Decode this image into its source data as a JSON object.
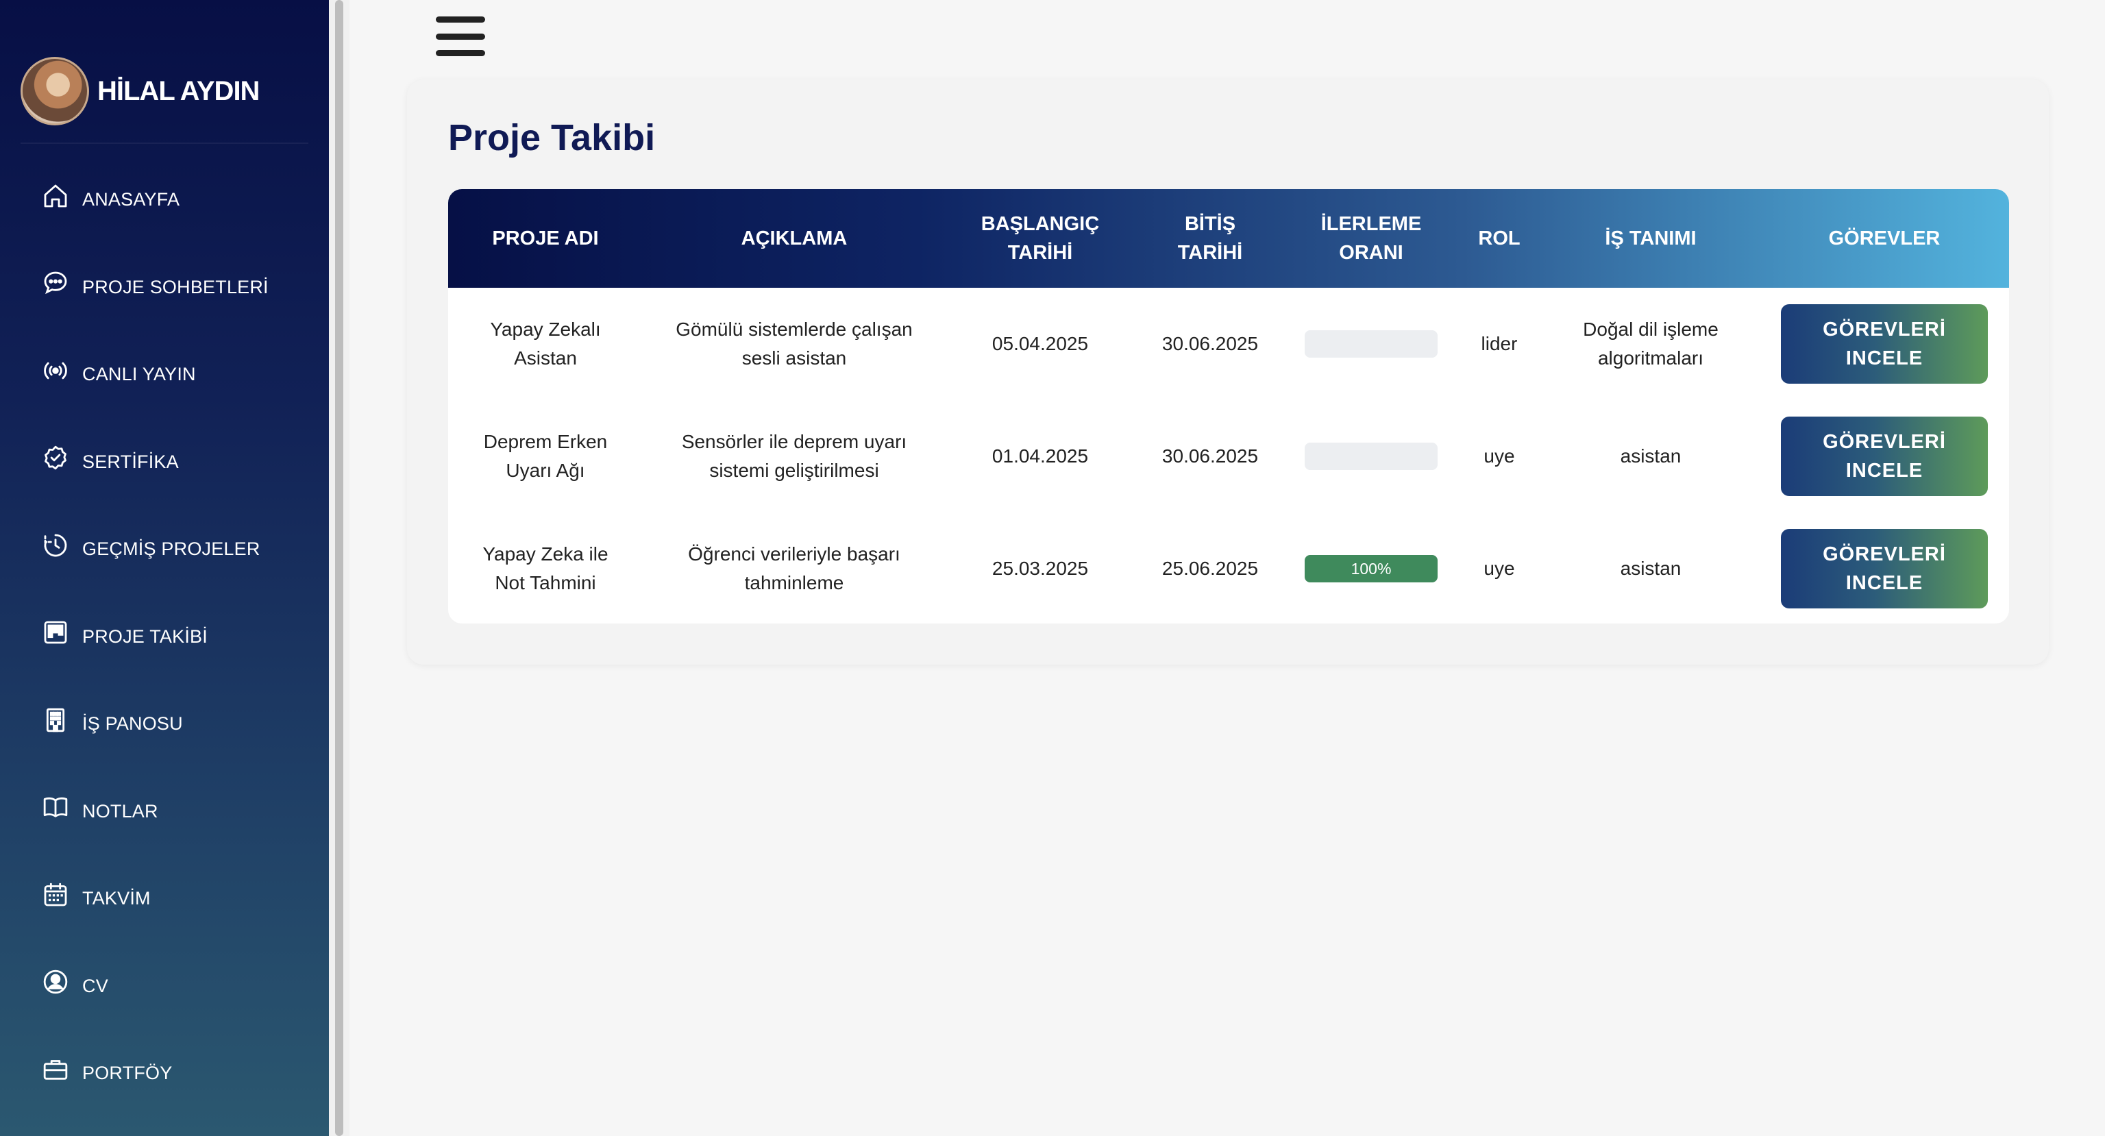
{
  "profile": {
    "name": "HİLAL AYDIN"
  },
  "sidebar": {
    "items": [
      {
        "label": "ANASAYFA",
        "icon": "home-icon"
      },
      {
        "label": "PROJE SOHBETLERİ",
        "icon": "chat-icon"
      },
      {
        "label": "CANLI YAYIN",
        "icon": "broadcast-icon"
      },
      {
        "label": "SERTİFİKA",
        "icon": "badge-check-icon"
      },
      {
        "label": "GEÇMİŞ PROJELER",
        "icon": "history-icon"
      },
      {
        "label": "PROJE TAKİBİ",
        "icon": "kanban-icon"
      },
      {
        "label": "İŞ PANOSU",
        "icon": "building-icon"
      },
      {
        "label": "NOTLAR",
        "icon": "book-icon"
      },
      {
        "label": "TAKVİM",
        "icon": "calendar-icon"
      },
      {
        "label": "CV",
        "icon": "user-circle-icon"
      },
      {
        "label": "PORTFÖY",
        "icon": "briefcase-icon"
      }
    ]
  },
  "page": {
    "title": "Proje Takibi"
  },
  "table": {
    "headers": [
      [
        "PROJE ADI"
      ],
      [
        "AÇIKLAMA"
      ],
      [
        "BAŞLANGIÇ",
        "TARİHİ"
      ],
      [
        "BİTİŞ",
        "TARİHİ"
      ],
      [
        "İLERLEME",
        "ORANI"
      ],
      [
        "ROL"
      ],
      [
        "İŞ TANIMI"
      ],
      [
        "GÖREVLER"
      ]
    ],
    "rows": [
      {
        "name": [
          "Yapay Zekalı",
          "Asistan"
        ],
        "description": [
          "Gömülü sistemlerde çalışan",
          "sesli asistan"
        ],
        "start": "05.04.2025",
        "end": "30.06.2025",
        "progress": 0,
        "progress_label": "",
        "role": "lider",
        "job": [
          "Doğal dil işleme",
          "algoritmaları"
        ],
        "button": [
          "GÖREVLERİ",
          "INCELE"
        ]
      },
      {
        "name": [
          "Deprem Erken",
          "Uyarı Ağı"
        ],
        "description": [
          "Sensörler ile deprem uyarı",
          "sistemi geliştirilmesi"
        ],
        "start": "01.04.2025",
        "end": "30.06.2025",
        "progress": 0,
        "progress_label": "",
        "role": "uye",
        "job": [
          "asistan"
        ],
        "button": [
          "GÖREVLERİ",
          "INCELE"
        ]
      },
      {
        "name": [
          "Yapay Zeka ile",
          "Not Tahmini"
        ],
        "description": [
          "Öğrenci verileriyle başarı",
          "tahminleme"
        ],
        "start": "25.03.2025",
        "end": "25.06.2025",
        "progress": 100,
        "progress_label": "100%",
        "role": "uye",
        "job": [
          "asistan"
        ],
        "button": [
          "GÖREVLERİ",
          "INCELE"
        ]
      }
    ]
  },
  "colors": {
    "accent_title": "#101a55",
    "progress_fill": "#3f8a5c"
  }
}
